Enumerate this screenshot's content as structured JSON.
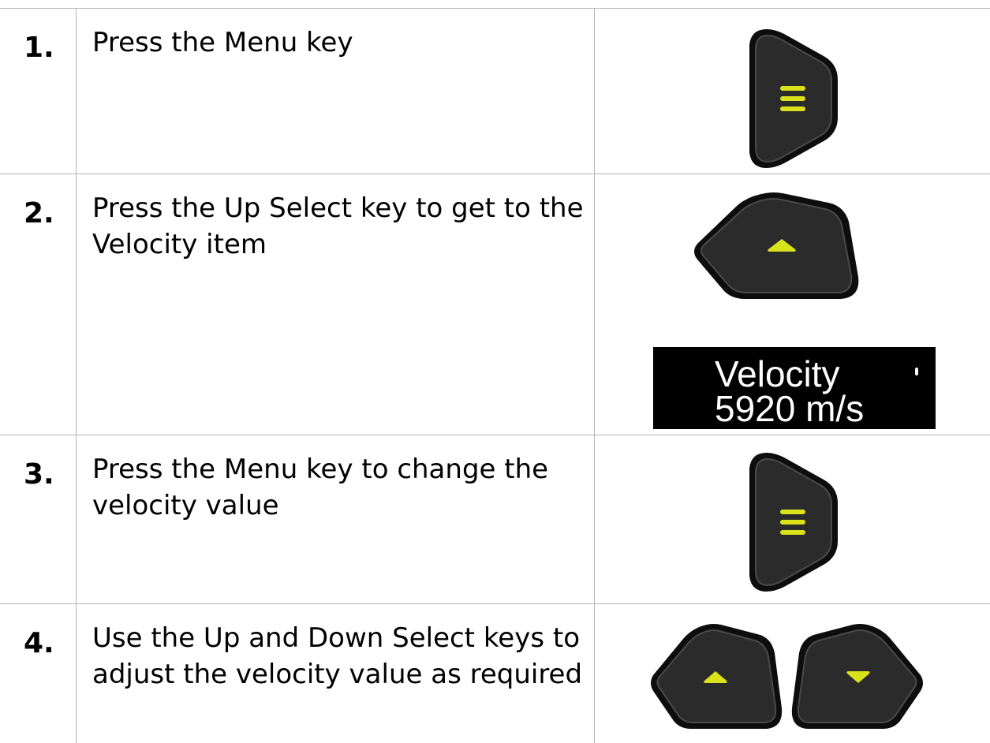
{
  "steps": [
    {
      "number": "1.",
      "instruction": "Press the Menu key",
      "keys": [
        "menu-key"
      ]
    },
    {
      "number": "2.",
      "instruction": "Press the Up Select key to get to the Velocity item",
      "keys": [
        "up-select-key"
      ],
      "display": {
        "line1": "Velocity",
        "line2": "5920 m/s"
      }
    },
    {
      "number": "3.",
      "instruction": "Press the Menu key to change the velocity value",
      "keys": [
        "menu-key"
      ]
    },
    {
      "number": "4.",
      "instruction": "Use the Up and Down Select keys to adjust the velocity value as required",
      "keys": [
        "up-select-key",
        "down-select-key"
      ]
    }
  ],
  "colors": {
    "key_body": "#2b2b2b",
    "key_outline": "#0d0d0d",
    "key_symbol": "#d9e21b",
    "border": "#b4b4b4",
    "display_bg": "#000000",
    "display_text": "#ffffff"
  }
}
